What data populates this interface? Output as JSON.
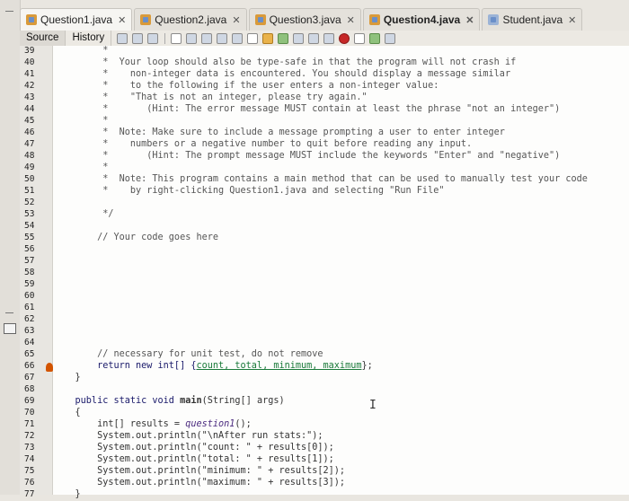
{
  "tabs": [
    {
      "label": "Question1.java",
      "active": true
    },
    {
      "label": "Question2.java",
      "active": false
    },
    {
      "label": "Question3.java",
      "active": false
    },
    {
      "label": "Question4.java",
      "active": false,
      "bold": true
    },
    {
      "label": "Student.java",
      "active": false
    }
  ],
  "toolbar": {
    "source": "Source",
    "history": "History"
  },
  "line_numbers": [
    "39",
    "40",
    "41",
    "42",
    "43",
    "44",
    "45",
    "46",
    "47",
    "48",
    "49",
    "50",
    "51",
    "52",
    "53",
    "54",
    "55",
    "56",
    "57",
    "58",
    "59",
    "60",
    "61",
    "62",
    "63",
    "64",
    "65",
    "66",
    "67",
    "68",
    "69",
    "70",
    "71",
    "72",
    "73",
    "74",
    "75",
    "76",
    "77"
  ],
  "code": {
    "l39": "         *",
    "l40": "         *  Your loop should also be type-safe in that the program will not crash if",
    "l41": "         *    non-integer data is encountered. You should display a message similar",
    "l42": "         *    to the following if the user enters a non-integer value:",
    "l43": "         *    \"That is not an integer, please try again.\"",
    "l44": "         *       (Hint: The error message MUST contain at least the phrase \"not an integer\")",
    "l45": "         *",
    "l46": "         *  Note: Make sure to include a message prompting a user to enter integer",
    "l47": "         *    numbers or a negative number to quit before reading any input.",
    "l48": "         *       (Hint: The prompt message MUST include the keywords \"Enter\" and \"negative\")",
    "l49": "         *",
    "l50": "         *  Note: This program contains a main method that can be used to manually test your code",
    "l51": "         *    by right-clicking Question1.java and selecting \"Run File\"",
    "l52": "",
    "l53": "         */",
    "l54": "",
    "l55": "        // Your code goes here",
    "l65_cmt": "        // necessary for unit test, do not remove",
    "l66_ret": "        return new int[] {",
    "l66_vals": "count, total, minimum, maximum",
    "l66_end": "};",
    "l67": "    }",
    "l69_a": "    public static void ",
    "l69_b": "main",
    "l69_c": "(String[] args)",
    "l70": "    {",
    "l71_a": "        int[] results = ",
    "l71_b": "question1",
    "l71_c": "();",
    "l72": "        System.out.println(\"\\nAfter run stats:\");",
    "l73": "        System.out.println(\"count: \" + results[0]);",
    "l74": "        System.out.println(\"total: \" + results[1]);",
    "l75": "        System.out.println(\"minimum: \" + results[2]);",
    "l76": "        System.out.println(\"maximum: \" + results[3]);",
    "l77": "    }"
  }
}
